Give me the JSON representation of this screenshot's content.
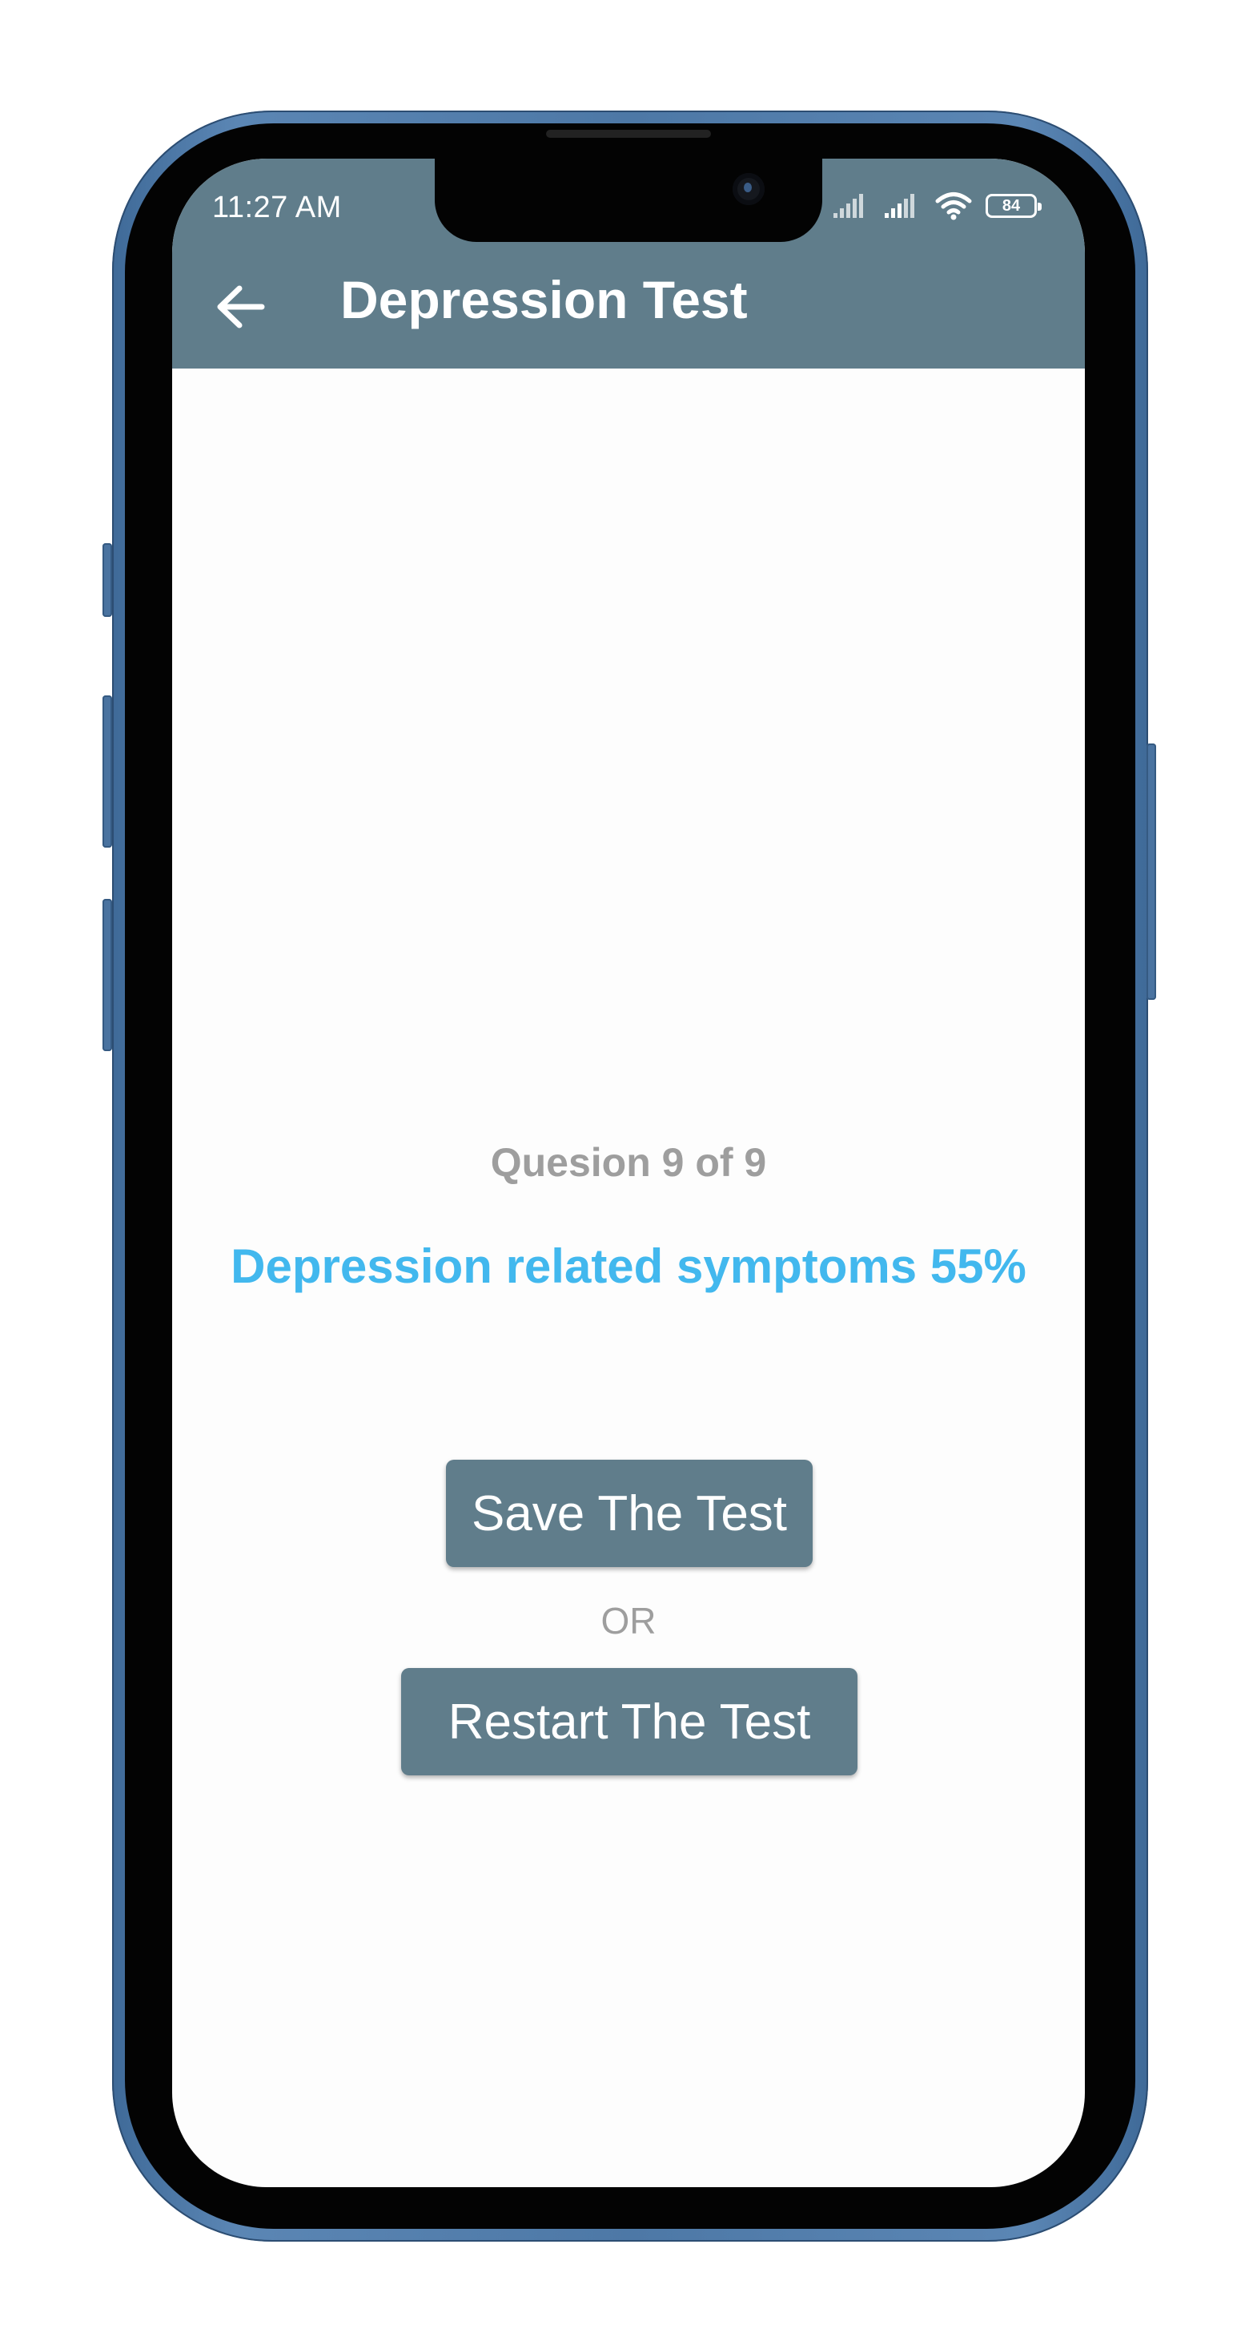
{
  "status_bar": {
    "time": "11:27 AM",
    "battery": "84"
  },
  "app_bar": {
    "title": "Depression Test"
  },
  "result": {
    "question_progress": "Quesion 9 of 9",
    "summary": "Depression related symptoms 55%"
  },
  "actions": {
    "save_label": "Save The Test",
    "separator": "OR",
    "restart_label": "Restart The Test"
  },
  "colors": {
    "app_bar": "#607d8b",
    "accent_text": "#42b8ee",
    "muted_text": "#9e9e9e",
    "button": "#607d8b"
  },
  "icons": {
    "back": "arrow-left-icon",
    "signal": "signal-icon",
    "wifi": "wifi-icon",
    "battery": "battery-icon"
  }
}
